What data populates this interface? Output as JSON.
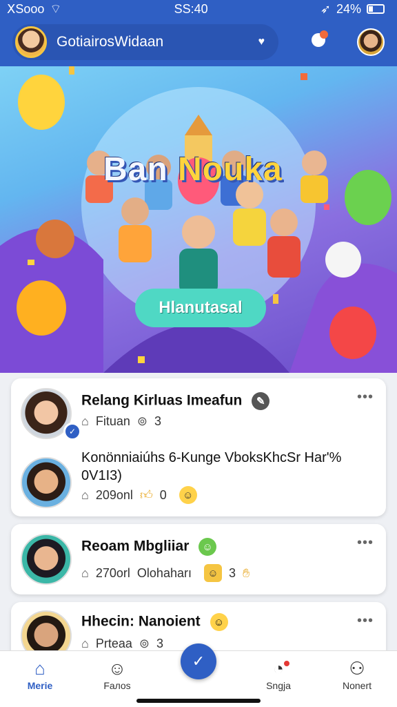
{
  "status_bar": {
    "carrier": "𝖷Sooo",
    "time": "SS:40",
    "battery": "24%"
  },
  "header": {
    "title": "GotiairosWidaan"
  },
  "hero": {
    "title_part1": "Ban ",
    "title_part2": "Nouka",
    "badge": "Hlanutasal"
  },
  "feed": [
    {
      "name": "Relang Kirluas Imeafun",
      "meta": [
        "Fituan",
        "3"
      ],
      "post_text": "Konönniaiúhs 6-Kunge VboksKhcSr Har'% 0V1Ι3)",
      "second_meta": [
        "209onl",
        "0"
      ]
    },
    {
      "name": "Reoam Mbgliiar",
      "meta": [
        "270orl",
        "Olohaharı",
        "3"
      ]
    },
    {
      "name": "Hhecin: Nanoient",
      "meta": [
        "Prteaa",
        "3"
      ]
    }
  ],
  "nav": {
    "home": "Merie",
    "faces": "Faлos",
    "stats": "Sngja",
    "profile": "Nonert"
  },
  "icons": [
    "wifi-icon",
    "location-icon",
    "heart-icon",
    "spark-icon",
    "more-icon",
    "home-icon",
    "smile-icon",
    "check-icon",
    "bell-icon",
    "user-icon"
  ]
}
